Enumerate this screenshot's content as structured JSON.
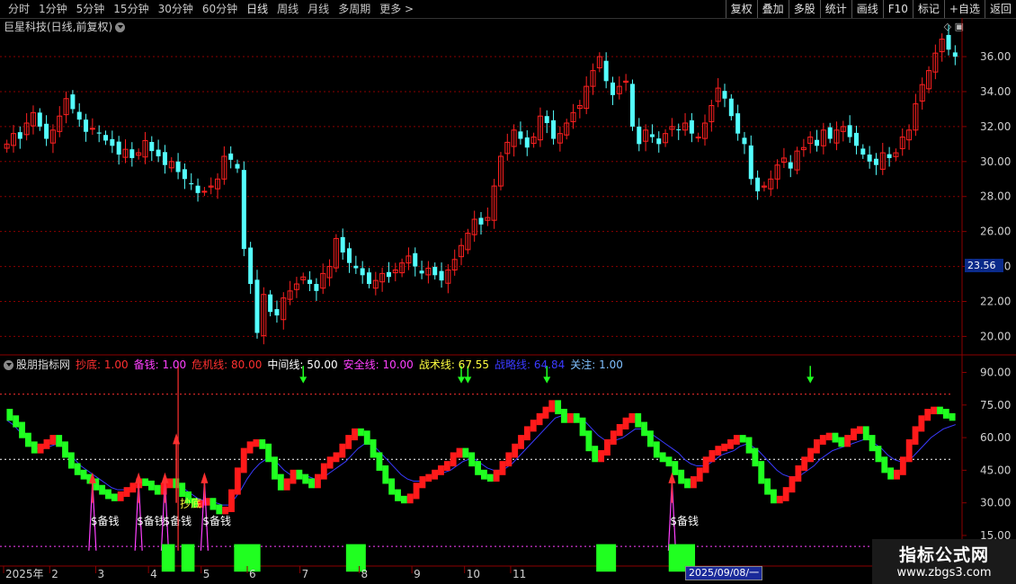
{
  "toolbar": {
    "periods": [
      "分时",
      "1分钟",
      "5分钟",
      "15分钟",
      "30分钟",
      "60分钟",
      "日线",
      "周线",
      "月线",
      "多周期",
      "更多 >"
    ],
    "active_period": "日线",
    "tools": [
      "复权",
      "叠加",
      "多股",
      "统计",
      "画线",
      "F10",
      "标记",
      "+自选",
      "返回"
    ]
  },
  "stock": {
    "title": "巨星科技(日线,前复权)"
  },
  "price_tag": "23.56",
  "date_tag": "2025/09/08/一",
  "colors": {
    "up": "#ff2020",
    "down": "#54ffff",
    "ind_up": "#ff1a1a",
    "ind_down": "#20ff20",
    "grid": "#8b0000",
    "axis": "#8b0000"
  },
  "indicator_legend": {
    "name": "股朋指标网",
    "items": [
      {
        "label": "抄底: 1.00",
        "color": "#ff3030"
      },
      {
        "label": "备钱: 1.00",
        "color": "#ff40ff"
      },
      {
        "label": "危机线: 80.00",
        "color": "#ff3030"
      },
      {
        "label": "中间线: 50.00",
        "color": "#ffffff"
      },
      {
        "label": "安全线: 10.00",
        "color": "#ff40ff"
      },
      {
        "label": "战术线: 67.55",
        "color": "#ffff40"
      },
      {
        "label": "战略线: 64.84",
        "color": "#3a3aff"
      },
      {
        "label": "关注: 1.00",
        "color": "#80c0ff"
      }
    ]
  },
  "signal_labels": {
    "beiqian": "$备钱",
    "chaodi": "抄底"
  },
  "watermark": {
    "line1": "指标公式网",
    "line2": "www.zbgs3.com"
  },
  "chart_data": {
    "type": "candlestick",
    "price_axis": {
      "ticks": [
        "36.00",
        "34.00",
        "32.00",
        "30.00",
        "28.00",
        "26.00",
        "24.00",
        "22.00",
        "20.00"
      ],
      "values": [
        36,
        34,
        32,
        30,
        28,
        26,
        24,
        22,
        20
      ],
      "range": [
        19.2,
        37.8
      ]
    },
    "indicator_axis": {
      "ticks": [
        "90.00",
        "75.00",
        "60.00",
        "45.00",
        "30.00",
        "15.00"
      ],
      "values": [
        90,
        75,
        60,
        45,
        30,
        15
      ],
      "range": [
        3,
        96
      ]
    },
    "x_axis_labels": [
      "2025年",
      "2",
      "3",
      "4",
      "5",
      "6",
      "7",
      "8",
      "9",
      "10",
      "11"
    ],
    "x_label_bars": [
      0,
      7,
      14,
      22,
      30,
      37,
      45,
      54,
      62,
      70,
      77
    ],
    "closes": [
      31.0,
      31.6,
      31.3,
      32.2,
      32.8,
      32.0,
      31.3,
      31.8,
      32.6,
      33.6,
      33.0,
      32.4,
      31.7,
      31.9,
      31.6,
      31.2,
      30.9,
      30.4,
      30.7,
      30.2,
      30.5,
      31.2,
      30.6,
      30.3,
      29.8,
      30.0,
      29.4,
      29.0,
      28.7,
      28.2,
      28.3,
      28.6,
      29.0,
      30.3,
      30.1,
      29.6,
      25.0,
      23.0,
      20.2,
      22.4,
      21.4,
      21.2,
      22.2,
      22.6,
      23.0,
      23.4,
      23.0,
      22.6,
      23.6,
      24.0,
      25.6,
      24.8,
      24.2,
      23.9,
      23.5,
      23.0,
      23.2,
      23.6,
      23.4,
      23.8,
      24.2,
      24.6,
      24.0,
      23.6,
      23.9,
      23.5,
      23.2,
      23.8,
      24.4,
      25.2,
      25.9,
      26.7,
      26.4,
      26.8,
      28.6,
      30.3,
      31.1,
      31.8,
      31.3,
      30.8,
      31.4,
      32.6,
      32.2,
      31.3,
      31.6,
      32.2,
      32.8,
      33.2,
      34.3,
      35.2,
      36.0,
      34.6,
      33.8,
      34.3,
      34.6,
      32.0,
      31.0,
      31.8,
      31.4,
      31.0,
      31.6,
      32.0,
      31.8,
      32.2,
      31.6,
      31.4,
      32.2,
      33.2,
      34.2,
      33.6,
      32.6,
      31.6,
      31.0,
      29.0,
      28.3,
      28.6,
      29.0,
      29.8,
      30.2,
      29.6,
      30.6,
      30.8,
      31.4,
      30.9,
      31.8,
      31.3,
      31.8,
      32.0,
      31.4,
      30.9,
      30.4,
      30.0,
      29.8,
      30.5,
      30.2,
      30.5,
      31.4,
      31.8,
      33.3,
      34.4,
      35.2,
      36.2,
      37.0,
      36.4,
      36.0
    ],
    "indicator": {
      "danger_line": 80,
      "mid_line": 50,
      "safe_line": 10,
      "tactic_line": [
        72,
        69,
        66,
        61,
        57,
        54,
        56,
        58,
        60,
        57,
        52,
        47,
        44,
        42,
        40,
        37,
        35,
        33,
        32,
        34,
        36,
        38,
        40,
        39,
        37,
        35,
        38,
        40,
        38,
        34,
        31,
        29,
        30,
        31,
        28,
        26,
        27,
        35,
        45,
        54,
        57,
        58,
        56,
        50,
        42,
        37,
        40,
        44,
        42,
        40,
        38,
        42,
        47,
        50,
        52,
        56,
        60,
        63,
        62,
        58,
        52,
        46,
        40,
        35,
        32,
        31,
        33,
        38,
        41,
        42,
        44,
        46,
        48,
        52,
        54,
        52,
        48,
        44,
        42,
        41,
        44,
        48,
        52,
        56,
        60,
        64,
        67,
        70,
        73,
        76,
        72,
        68,
        70,
        68,
        62,
        55,
        50,
        53,
        58,
        62,
        65,
        68,
        70,
        66,
        62,
        57,
        52,
        50,
        48,
        44,
        40,
        38,
        41,
        45,
        50,
        53,
        55,
        56,
        58,
        60,
        59,
        54,
        48,
        40,
        35,
        31,
        32,
        36,
        41,
        46,
        50,
        54,
        58,
        60,
        61,
        59,
        57,
        60,
        63,
        64,
        60,
        55,
        50,
        45,
        42,
        44,
        50,
        58,
        64,
        69,
        72,
        73,
        72,
        70,
        69
      ],
      "strategy_line": [
        68,
        66,
        63,
        60,
        57,
        55,
        55,
        56,
        57,
        56,
        53,
        50,
        47,
        45,
        43,
        41,
        39,
        37,
        36,
        36,
        37,
        38,
        39,
        39,
        38,
        37,
        37,
        38,
        38,
        36,
        34,
        32,
        31,
        31,
        30,
        29,
        29,
        32,
        36,
        41,
        45,
        48,
        50,
        50,
        48,
        45,
        43,
        43,
        43,
        42,
        41,
        41,
        43,
        45,
        47,
        49,
        52,
        55,
        57,
        57,
        55,
        52,
        49,
        46,
        43,
        41,
        40,
        40,
        41,
        42,
        43,
        44,
        45,
        47,
        49,
        50,
        50,
        48,
        46,
        45,
        45,
        46,
        48,
        51,
        54,
        57,
        60,
        63,
        66,
        69,
        70,
        70,
        70,
        69,
        67,
        64,
        61,
        59,
        59,
        59,
        60,
        62,
        64,
        64,
        63,
        61,
        59,
        57,
        55,
        53,
        50,
        48,
        47,
        47,
        48,
        50,
        52,
        53,
        54,
        56,
        57,
        56,
        54,
        51,
        48,
        45,
        43,
        42,
        42,
        43,
        45,
        47,
        50,
        52,
        54,
        55,
        56,
        57,
        58,
        59,
        59,
        57,
        55,
        52,
        50,
        49,
        49,
        51,
        54,
        57,
        60,
        62,
        64,
        65,
        66
      ]
    },
    "buy_signals_bars": [
      13,
      20,
      24,
      30,
      101
    ],
    "chaodi_bar": 26,
    "green_blocks_bars": [
      [
        24,
        25
      ],
      [
        27,
        28
      ],
      [
        35,
        38
      ],
      [
        52,
        54
      ],
      [
        90,
        92
      ],
      [
        101,
        104
      ]
    ],
    "arrows_top_bars": [
      45,
      69,
      70,
      82,
      122
    ]
  }
}
